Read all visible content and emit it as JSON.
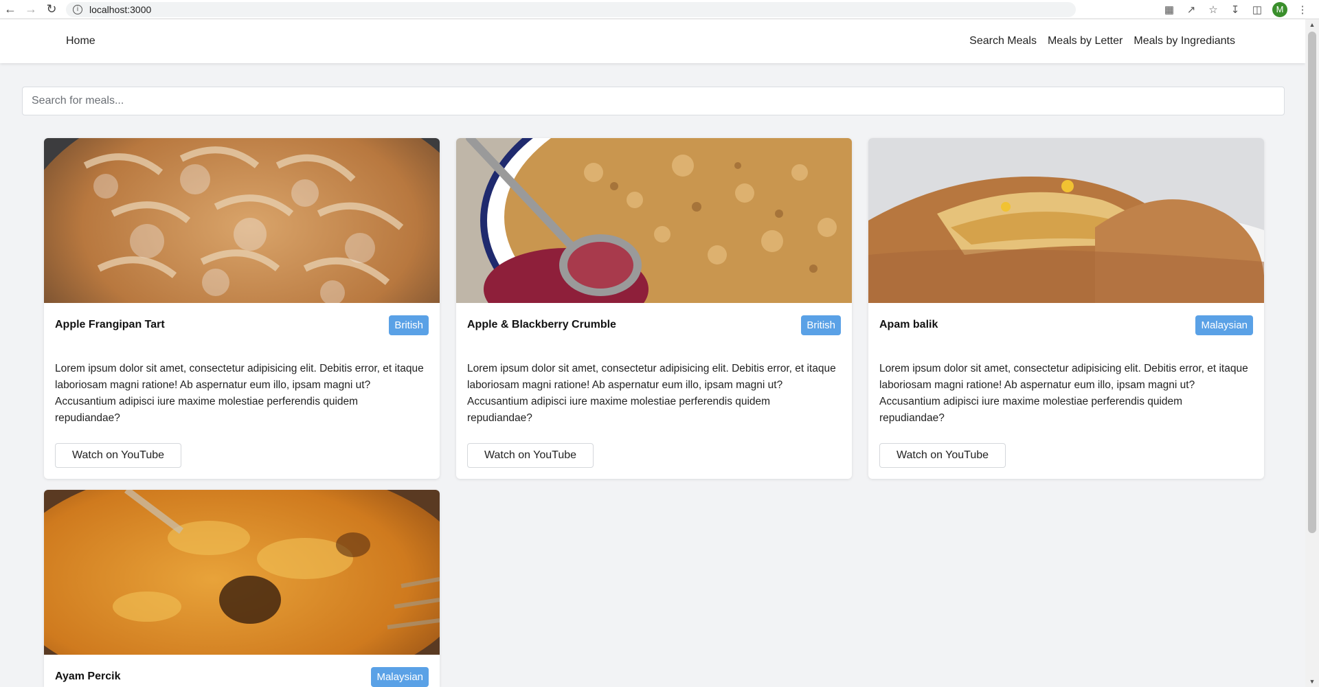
{
  "browser": {
    "url": "localhost:3000",
    "avatar_letter": "M",
    "accent": "#3a8f2c"
  },
  "nav": {
    "home": "Home",
    "links": [
      "Search Meals",
      "Meals by Letter",
      "Meals by Ingrediants"
    ]
  },
  "search": {
    "placeholder": "Search for meals...",
    "value": ""
  },
  "meals": [
    {
      "title": "Apple Frangipan Tart",
      "area": "British",
      "description": "Lorem ipsum dolor sit amet, consectetur adipisicing elit. Debitis error, et itaque laboriosam magni ratione! Ab aspernatur eum illo, ipsam magni ut? Accusantium adipisci iure maxime molestiae perferendis quidem repudiandae?",
      "button": "Watch on YouTube"
    },
    {
      "title": "Apple & Blackberry Crumble",
      "area": "British",
      "description": "Lorem ipsum dolor sit amet, consectetur adipisicing elit. Debitis error, et itaque laboriosam magni ratione! Ab aspernatur eum illo, ipsam magni ut? Accusantium adipisci iure maxime molestiae perferendis quidem repudiandae?",
      "button": "Watch on YouTube"
    },
    {
      "title": "Apam balik",
      "area": "Malaysian",
      "description": "Lorem ipsum dolor sit amet, consectetur adipisicing elit. Debitis error, et itaque laboriosam magni ratione! Ab aspernatur eum illo, ipsam magni ut? Accusantium adipisci iure maxime molestiae perferendis quidem repudiandae?",
      "button": "Watch on YouTube"
    },
    {
      "title": "Ayam Percik",
      "area": "Malaysian"
    }
  ],
  "colors": {
    "badge": "#5aa1e6",
    "page_bg": "#f2f3f5"
  }
}
